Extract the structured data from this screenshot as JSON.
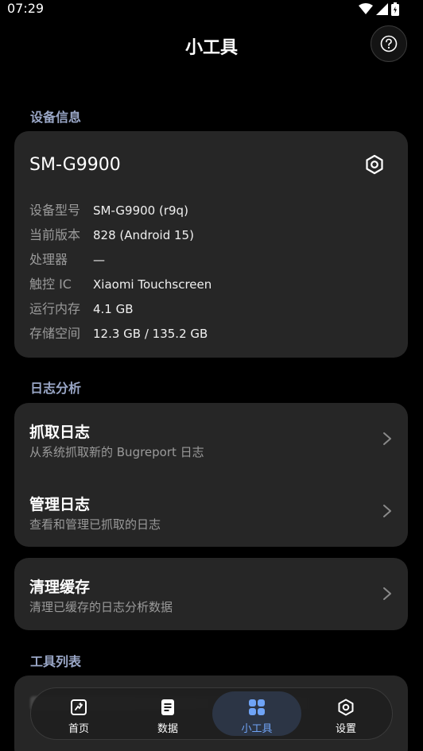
{
  "status_bar": {
    "time": "07:29"
  },
  "header": {
    "title": "小工具"
  },
  "device_section": {
    "label": "设备信息",
    "device_name": "SM-G9900",
    "rows": [
      {
        "label": "设备型号",
        "value": "SM-G9900 (r9q)"
      },
      {
        "label": "当前版本",
        "value": "828 (Android 15)"
      },
      {
        "label": "处理器",
        "value": "—"
      },
      {
        "label": "触控 IC",
        "value": "Xiaomi Touchscreen"
      },
      {
        "label": "运行内存",
        "value": "4.1 GB"
      },
      {
        "label": "存储空间",
        "value": "12.3 GB / 135.2 GB"
      }
    ]
  },
  "log_section": {
    "label": "日志分析",
    "items": [
      {
        "title": "抓取日志",
        "subtitle": "从系统抓取新的 Bugreport 日志"
      },
      {
        "title": "管理日志",
        "subtitle": "查看和管理已抓取的日志"
      }
    ],
    "cache": {
      "title": "清理缓存",
      "subtitle": "清理已缓存的日志分析数据"
    }
  },
  "tools_section": {
    "label": "工具列表"
  },
  "bottom_nav": {
    "items": [
      {
        "label": "首页",
        "icon": "home-icon"
      },
      {
        "label": "数据",
        "icon": "data-icon"
      },
      {
        "label": "小工具",
        "icon": "tools-icon"
      },
      {
        "label": "设置",
        "icon": "settings-icon"
      }
    ],
    "active": "小工具"
  },
  "colors": {
    "background": "#000000",
    "card": "#262626",
    "section_label": "#9aa7c7",
    "accent": "#6fa3f5",
    "nav_active_bg": "#2c3545"
  }
}
